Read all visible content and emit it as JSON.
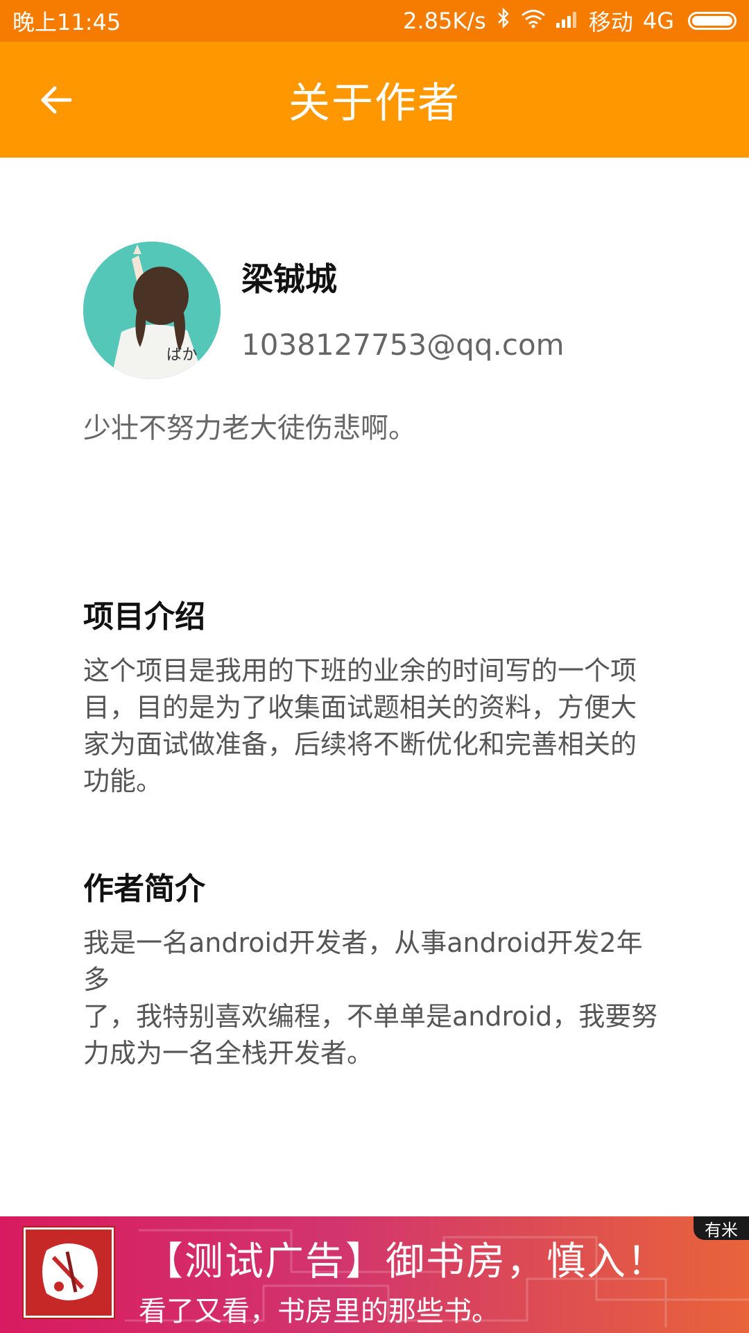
{
  "status_bar": {
    "time": "晚上11:45",
    "speed": "2.85K/s",
    "carrier": "移动",
    "network": "4G",
    "icons": [
      "bluetooth-icon",
      "wifi-icon",
      "signal-icon",
      "battery-icon"
    ]
  },
  "toolbar": {
    "title": "关于作者",
    "back_icon": "arrow-left-icon"
  },
  "profile": {
    "name": "梁铖城",
    "email": "1038127753@qq.com",
    "motto": "少壮不努力老大徒伤悲啊。"
  },
  "sections": [
    {
      "title": "项目介绍",
      "lines": [
        "这个项目是我用的下班的业余的时间写的一个项",
        "目，目的是为了收集面试题相关的资料，方便大",
        "家为面试做准备，后续将不断优化和完善相关的",
        "功能。"
      ]
    },
    {
      "title": "作者简介",
      "lines": [
        "我是一名android开发者，从事android开发2年多",
        "了，我特别喜欢编程，不单单是android，我要努",
        "力成为一名全栈开发者。"
      ]
    }
  ],
  "ad": {
    "title": "【测试广告】御书房，慎入！",
    "subtitle": "看了又看，书房里的那些书。",
    "badge": "有米"
  },
  "colors": {
    "status_bar": "#f57c00",
    "toolbar": "#ff9800",
    "ad_start": "#d81b60",
    "ad_end": "#e8643a"
  }
}
